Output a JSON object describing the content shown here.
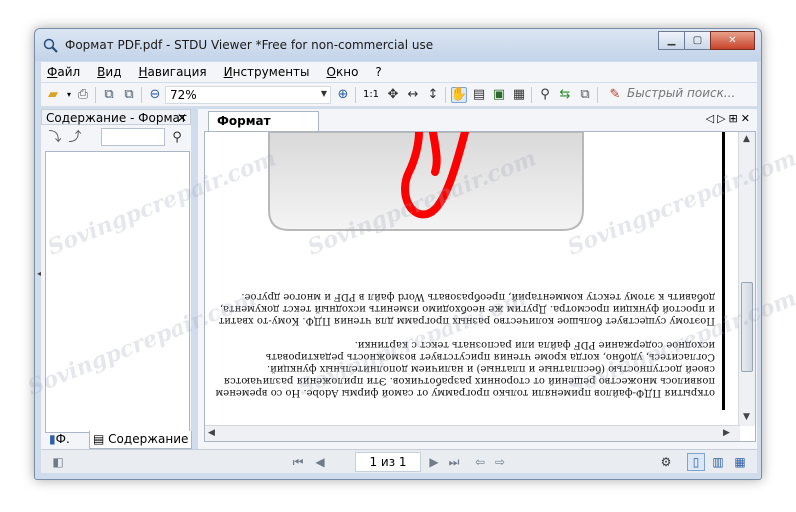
{
  "window": {
    "title": "Формат PDF.pdf - STDU Viewer *Free for non-commercial use"
  },
  "menu": [
    "Файл",
    "Вид",
    "Навигация",
    "Инструменты",
    "Окно",
    "?"
  ],
  "toolbar": {
    "zoom_value": "72%",
    "one_to_one": "1:1",
    "search_placeholder": "Быстрый поиск..."
  },
  "sidebar": {
    "header": "Содержание - Формат",
    "close": "✕",
    "tabs": [
      "Ф.",
      "Содержание"
    ]
  },
  "document": {
    "tab_label": "Формат PDF.pdf",
    "tab_controls": "◁▷⊞✕",
    "paragraphs": [
      "открытия ПДФ-файлов применяли только программу от самой фирмы Adobe. Но со временем появилось множество решений от сторонних разработчиков. Эти приложения различаются своей доступностью (бесплатные и платные) и наличием дополнительных функций. Согласитесь, удобно, когда кроме чтения присутствует возможность редактировать исходное содержание PDF файла или распознать текст с картинки.",
      "Поэтому существует большое количество разных программ для чтения ПДФ. Кому-то хватит и простой функции просмотра. Другим же необходимо изменить исходный текст документа, добавить к этому тексту комментарий, преобразовать Word файл в PDF и многое другое."
    ]
  },
  "statusbar": {
    "page_indicator": "1 из 1"
  },
  "watermark_text": "Sovingpcrepair.com"
}
